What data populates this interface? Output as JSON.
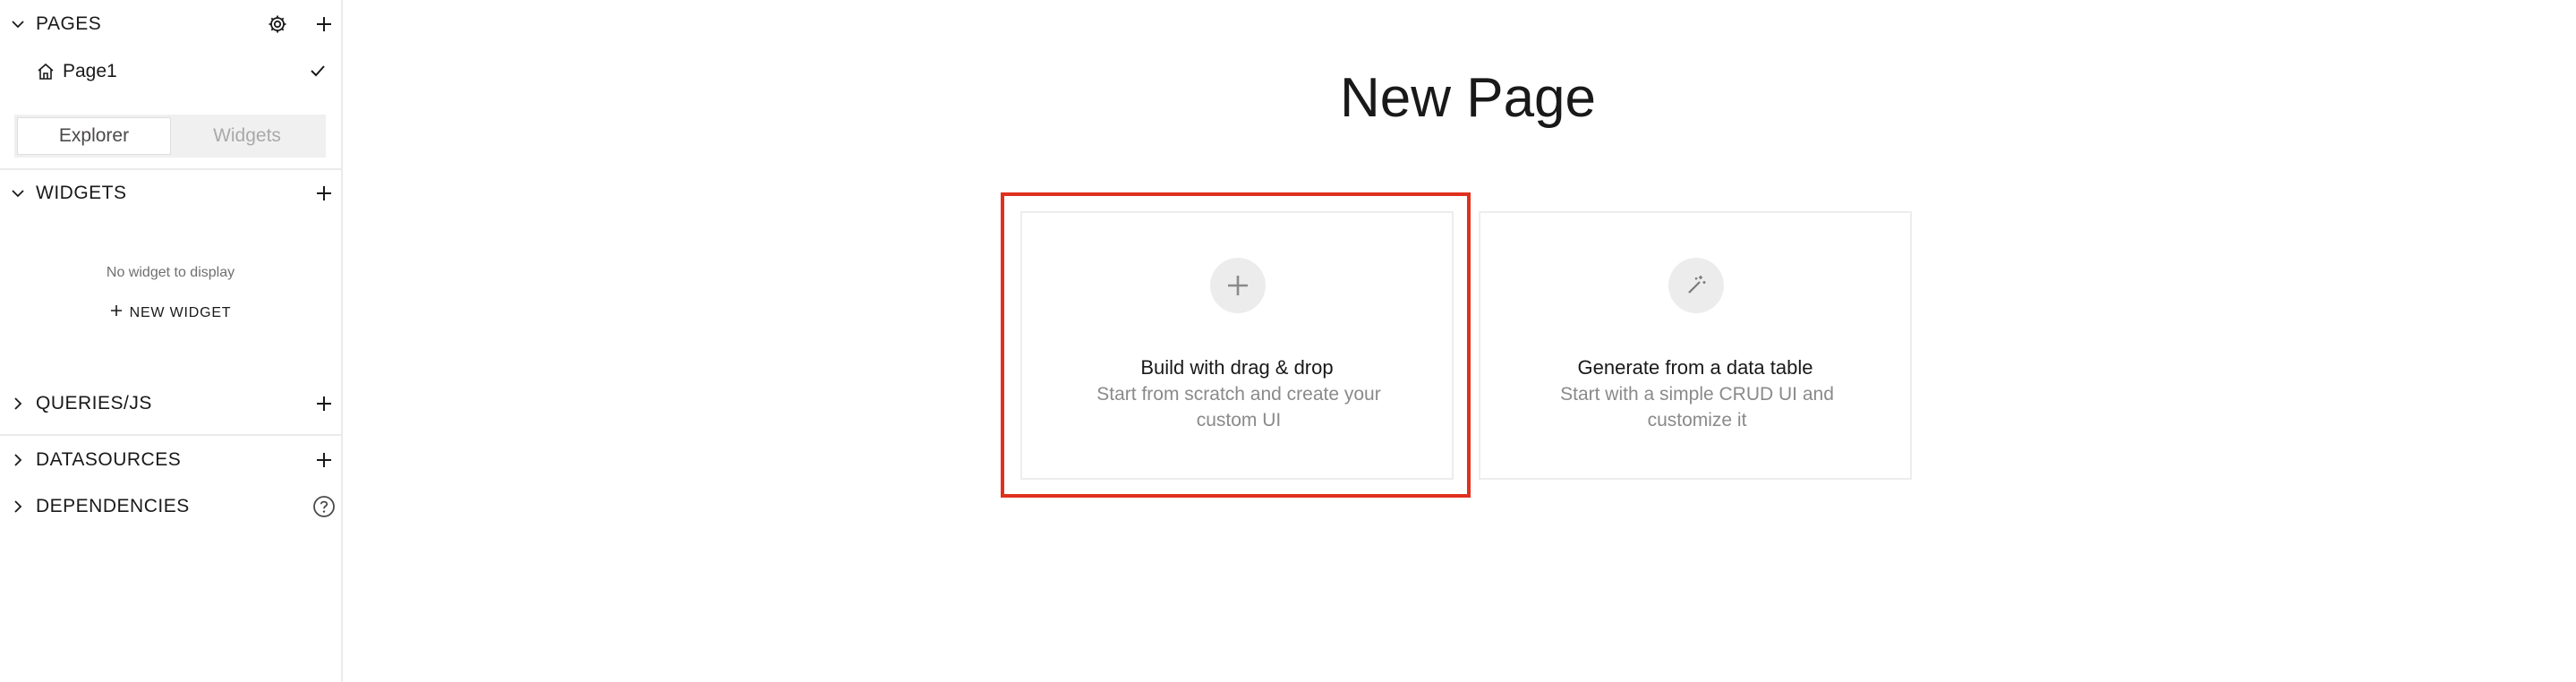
{
  "sidebar": {
    "pages": {
      "title": "PAGES",
      "items": [
        {
          "label": "Page1"
        }
      ]
    },
    "tabs": [
      {
        "label": "Explorer",
        "active": true
      },
      {
        "label": "Widgets",
        "active": false
      }
    ],
    "widgets": {
      "title": "WIDGETS",
      "empty_text": "No widget to display",
      "new_label": "NEW WIDGET"
    },
    "queries": {
      "title": "QUERIES/JS"
    },
    "datasources": {
      "title": "DATASOURCES"
    },
    "dependencies": {
      "title": "DEPENDENCIES"
    }
  },
  "main": {
    "title": "New Page",
    "cards": [
      {
        "title": "Build with drag & drop",
        "description": "Start from scratch and create your custom UI",
        "icon": "plus-icon",
        "highlighted": true
      },
      {
        "title": "Generate from a data table",
        "description": "Start with a simple CRUD UI and customize it",
        "icon": "magic-wand-icon",
        "highlighted": false
      }
    ]
  },
  "colors": {
    "highlight": "#e0301e",
    "text": "#191919",
    "muted": "#8a8a8a"
  }
}
